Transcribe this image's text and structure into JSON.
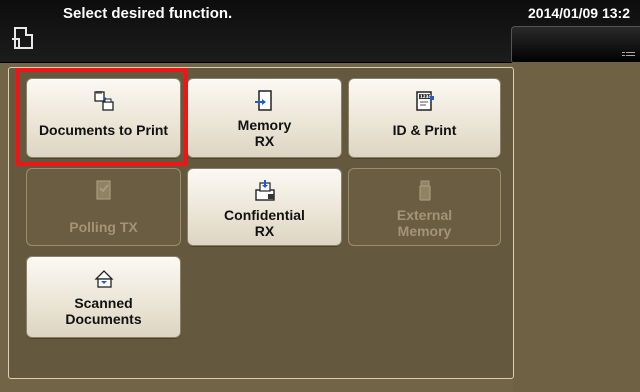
{
  "header": {
    "title": "Select desired function.",
    "datetime": "2014/01/09 13:2"
  },
  "functions": [
    {
      "label_line1": "Documents to Print",
      "label_line2": "",
      "icon": "documents-to-print-icon",
      "enabled": true,
      "selected": true
    },
    {
      "label_line1": "Memory",
      "label_line2": "RX",
      "icon": "memory-rx-icon",
      "enabled": true,
      "selected": false
    },
    {
      "label_line1": "ID & Print",
      "label_line2": "",
      "icon": "id-print-icon",
      "enabled": true,
      "selected": false
    },
    {
      "label_line1": "Polling TX",
      "label_line2": "",
      "icon": "polling-tx-icon",
      "enabled": false,
      "selected": false
    },
    {
      "label_line1": "Confidential",
      "label_line2": "RX",
      "icon": "confidential-rx-icon",
      "enabled": true,
      "selected": false
    },
    {
      "label_line1": "External",
      "label_line2": "Memory",
      "icon": "external-memory-icon",
      "enabled": false,
      "selected": false
    },
    {
      "label_line1": "Scanned",
      "label_line2": "Documents",
      "icon": "scanned-documents-icon",
      "enabled": true,
      "selected": false
    }
  ],
  "colors": {
    "background": "#726447",
    "button_face": "#ece6d8",
    "selection_outline": "#f01515",
    "header": "#111111"
  }
}
